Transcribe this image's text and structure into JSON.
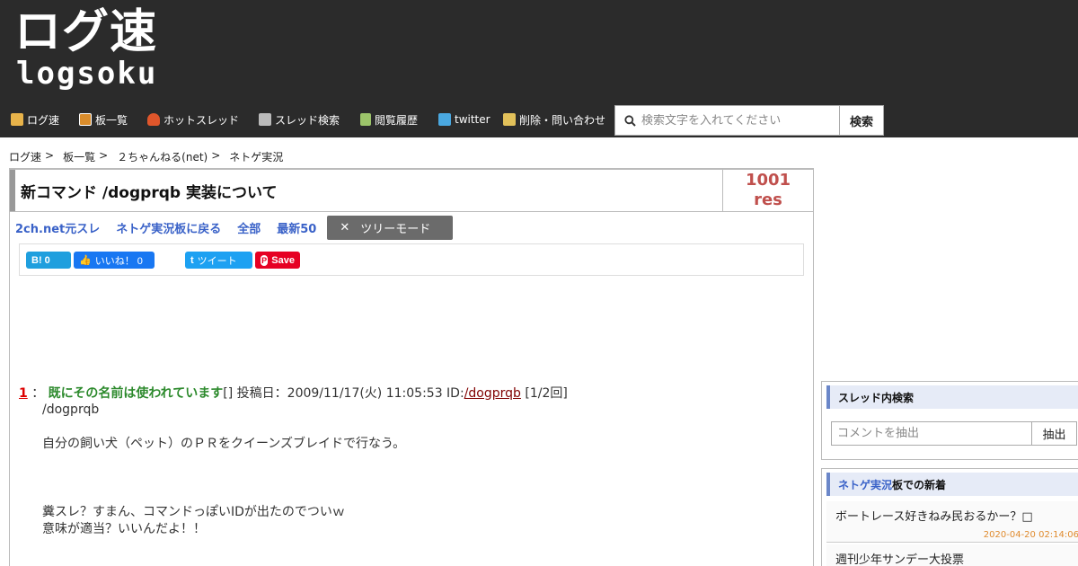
{
  "logo": {
    "jp": "ログ速",
    "en": "logsoku"
  },
  "nav": [
    {
      "label": "ログ速",
      "icon": "home-icon",
      "color": "#e8b34a"
    },
    {
      "label": "板一覧",
      "icon": "board-list-icon",
      "color": "#d98c2b"
    },
    {
      "label": "ホットスレッド",
      "icon": "fire-icon",
      "color": "#e0562b"
    },
    {
      "label": "スレッド検索",
      "icon": "thread-search-icon",
      "color": "#bbbbbb"
    },
    {
      "label": "閲覧履歴",
      "icon": "history-icon",
      "color": "#9cc46a"
    },
    {
      "label": "twitter",
      "icon": "twitter-icon",
      "color": "#4aa8e0"
    },
    {
      "label": "削除・問い合わせ",
      "icon": "contact-icon",
      "color": "#e2c15a"
    }
  ],
  "search": {
    "placeholder": "検索文字を入れてください",
    "button": "検索"
  },
  "breadcrumb": [
    {
      "label": "ログ速",
      "sep": ">"
    },
    {
      "label": "板一覧",
      "sep": ">"
    },
    {
      "label": "２ちゃんねる(net)",
      "sep": ">"
    },
    {
      "label": "ネトゲ実況",
      "sep": ""
    }
  ],
  "thread": {
    "title": "新コマンド /dogprqb 実装について",
    "res_count": "1001",
    "res_unit": "res",
    "links": [
      "2ch.net元スレ",
      "ネトゲ実況板に戻る",
      "全部",
      "最新50"
    ],
    "tree_mode": "ツリーモード"
  },
  "share": {
    "hatena": "B! 0",
    "fb": "いいね！ 0",
    "tw": "ツイート",
    "pin": "Save"
  },
  "post": {
    "num": "1",
    "colon": "：",
    "name": "既にその名前は使われています",
    "brackets": "[]",
    "date": "投稿日：2009/11/17(火) 11:05:53 ID:",
    "id": "/dogprqb",
    "count": "[1/2回]",
    "lines": [
      "/dogprqb",
      "",
      "自分の飼い犬（ペット）のＰＲをクイーンズブレイドで行なう。",
      "",
      "",
      "",
      "糞スレ？すまん、コマンドっぽいIDが出たのでついｗ",
      "意味が適当？いいんだよ！！"
    ]
  },
  "sidebar": {
    "search_title": "スレッド内検索",
    "search_placeholder": "コメントを抽出",
    "search_button": "抽出",
    "new_board": "ネトゲ実況",
    "new_title_suffix": "板での新着",
    "new_items": [
      {
        "title": "ボートレース好きねみ民おるかー？",
        "mark": "□",
        "date": "2020-04-20 02:14:06"
      },
      {
        "title": "週刊少年サンデー大投票",
        "mark": "",
        "date": ""
      }
    ]
  }
}
